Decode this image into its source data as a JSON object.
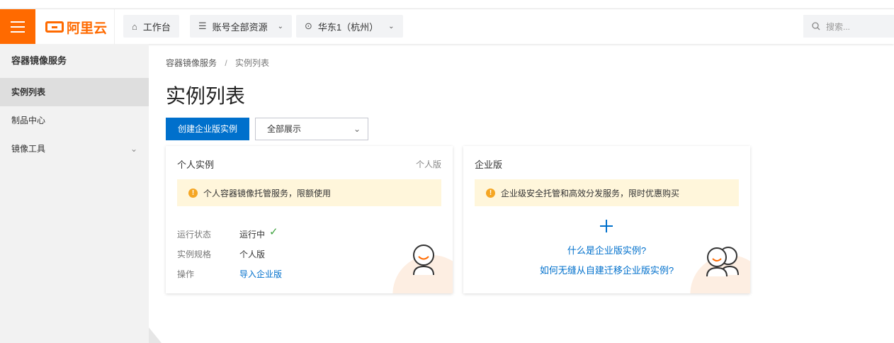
{
  "header": {
    "logo_text": "阿里云",
    "workbench_label": "工作台",
    "resources_label": "账号全部资源",
    "region_label": "华东1（杭州）",
    "search_placeholder": "搜索..."
  },
  "sidebar": {
    "title": "容器镜像服务",
    "items": [
      {
        "label": "实例列表",
        "active": true
      },
      {
        "label": "制品中心"
      },
      {
        "label": "镜像工具",
        "expandable": true
      }
    ]
  },
  "main": {
    "breadcrumb": [
      "容器镜像服务",
      "实例列表"
    ],
    "breadcrumb_sep": "/",
    "title": "实例列表",
    "create_button": "创建企业版实例",
    "filter_select": "全部展示"
  },
  "personal_card": {
    "title": "个人实例",
    "tag": "个人版",
    "notice": "个人容器镜像托管服务，限额使用",
    "rows": [
      {
        "key": "运行状态",
        "value": "运行中"
      },
      {
        "key": "实例规格",
        "value": "个人版"
      },
      {
        "key": "操作",
        "value": "导入企业版"
      }
    ]
  },
  "enterprise_card": {
    "title": "企业版",
    "notice": "企业级安全托管和高效分发服务，限时优惠购买",
    "link1": "什么是企业版实例?",
    "link2": "如何无缝从自建迁移企业版实例?"
  },
  "colors": {
    "brand": "#ff6a00",
    "primary": "#0070cc",
    "notice_bg": "#fff6db",
    "warning": "#f5a623",
    "success": "#3fa33f"
  }
}
